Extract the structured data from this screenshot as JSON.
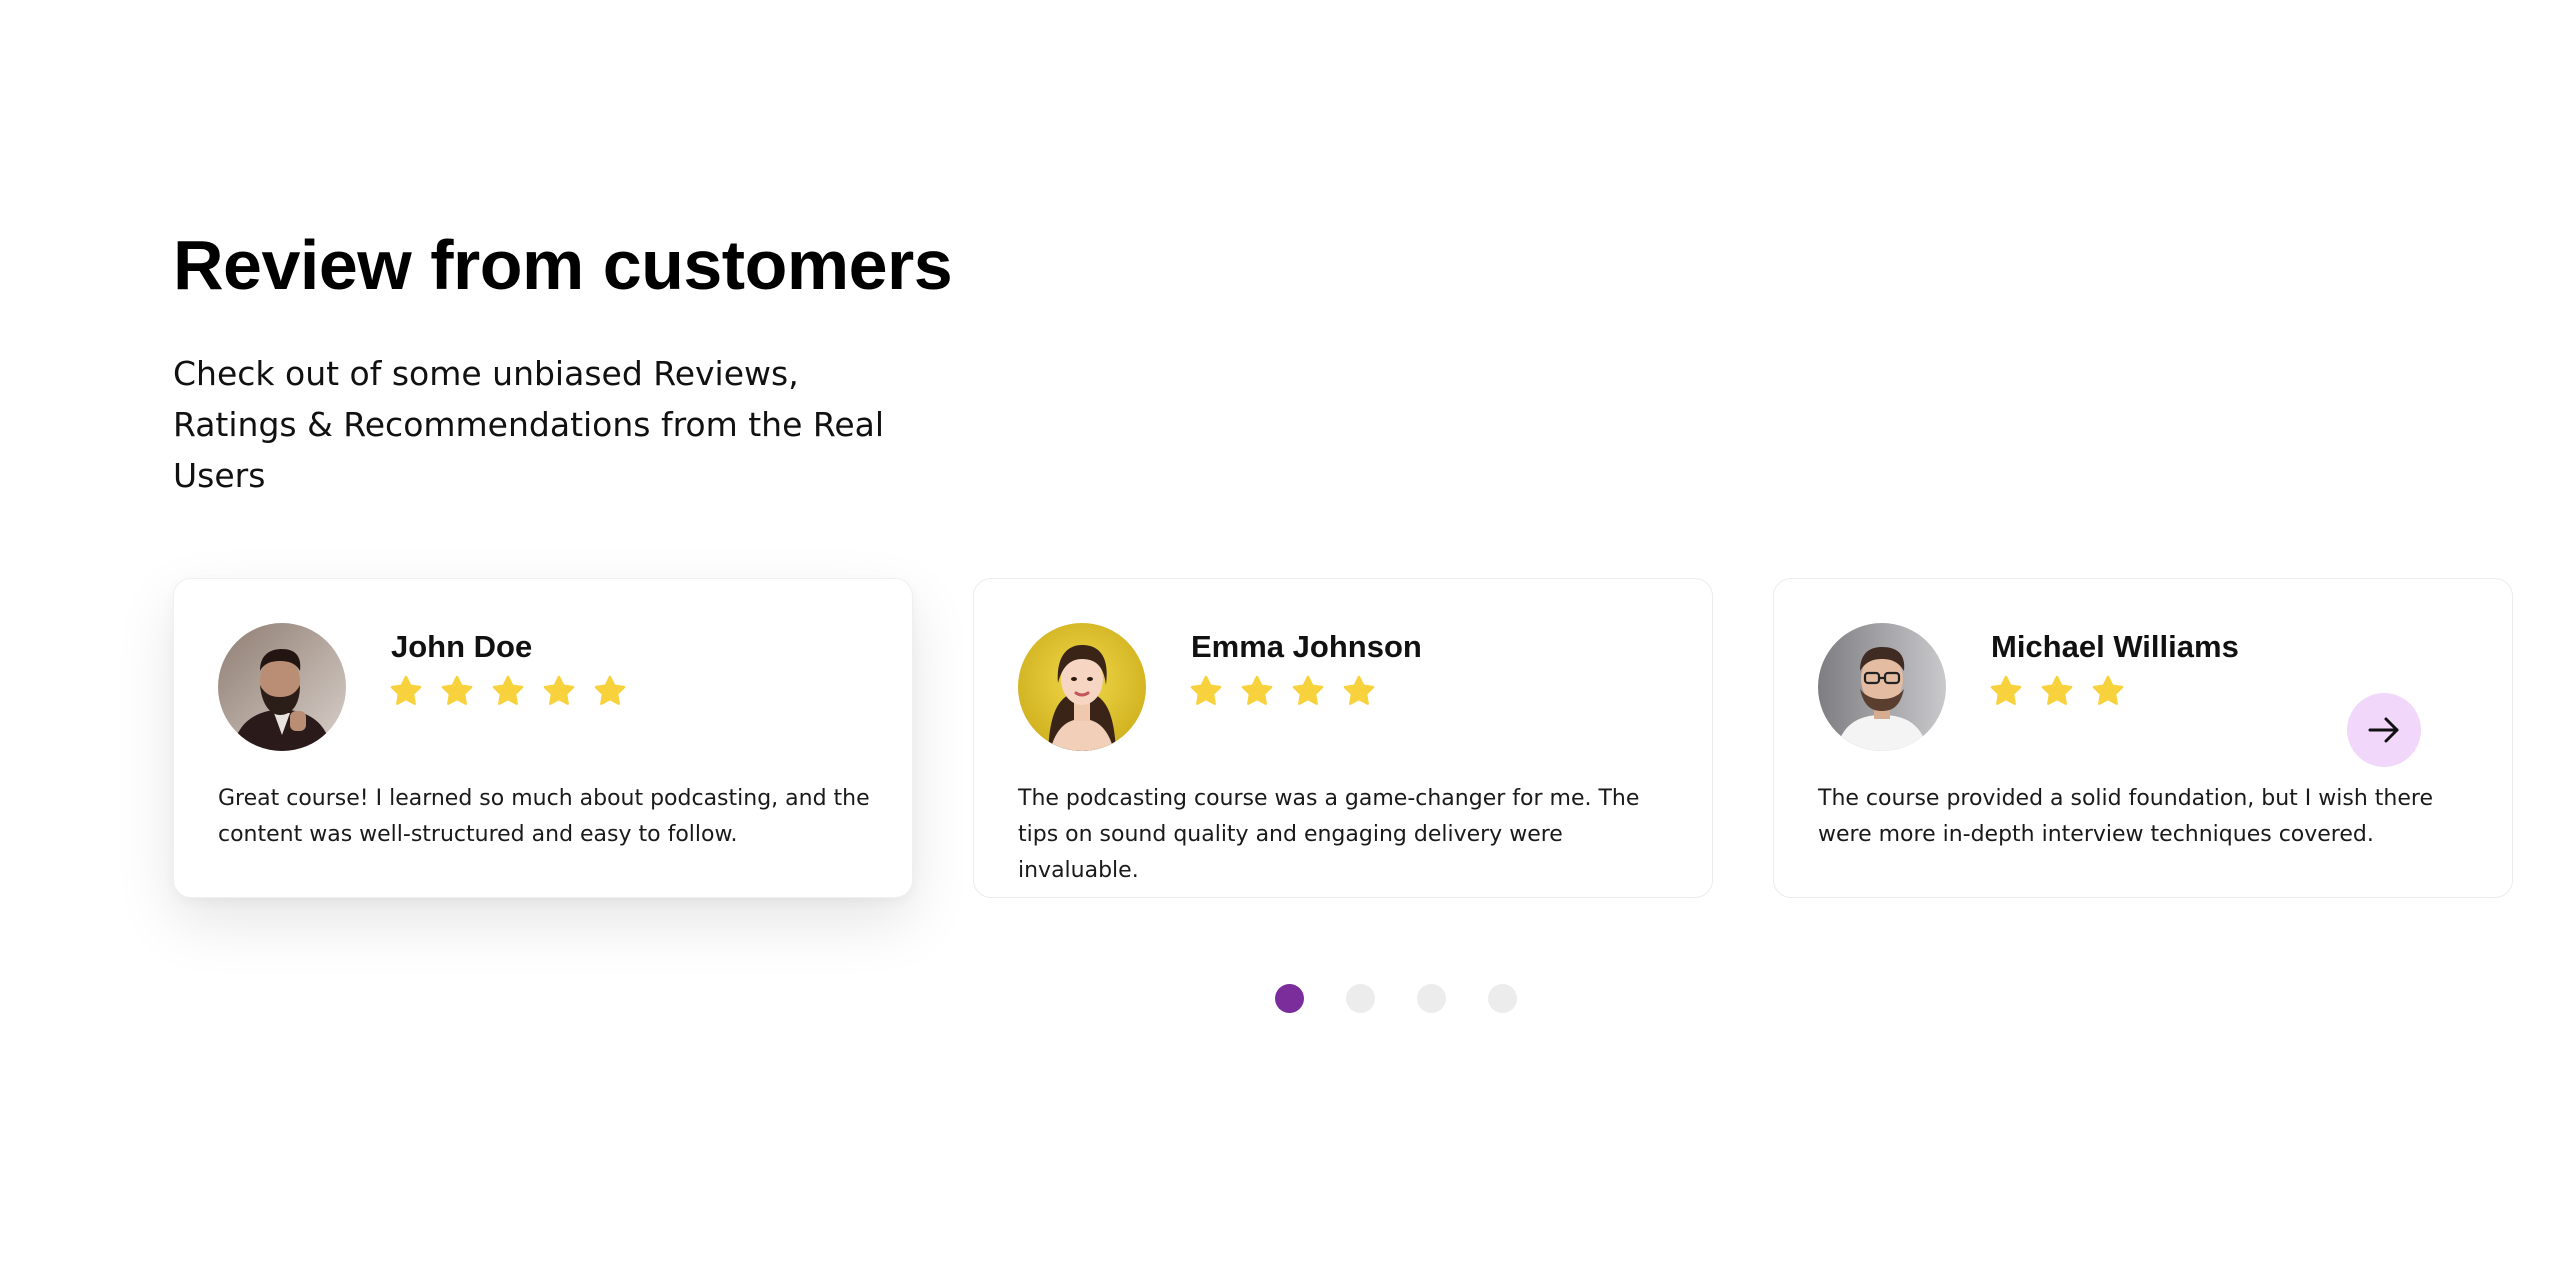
{
  "section": {
    "title": "Review from customers",
    "subtitle": "Check out of some unbiased Reviews, Ratings & Recommendations from the Real Users"
  },
  "reviews": [
    {
      "name": "John Doe",
      "rating": 5,
      "text": "Great course! I learned so much about podcasting, and the content was well-structured and easy to follow.",
      "avatar_icon": "avatar-bearded-man"
    },
    {
      "name": "Emma Johnson",
      "rating": 4,
      "text": "The podcasting course was a game-changer for me. The tips on sound quality and engaging delivery were invaluable.",
      "avatar_icon": "avatar-woman"
    },
    {
      "name": "Michael Williams",
      "rating": 3,
      "text": "The course provided a solid foundation, but I wish there were more in-depth interview techniques covered.",
      "avatar_icon": "avatar-man-glasses"
    }
  ],
  "carousel": {
    "page_count": 4,
    "active_page": 1,
    "next_icon": "arrow-right-icon"
  },
  "colors": {
    "star": "#f8d23c",
    "dot_active": "#7a2d9b",
    "dot_inactive": "#ececec",
    "next_button_bg": "#f1d8fb"
  }
}
